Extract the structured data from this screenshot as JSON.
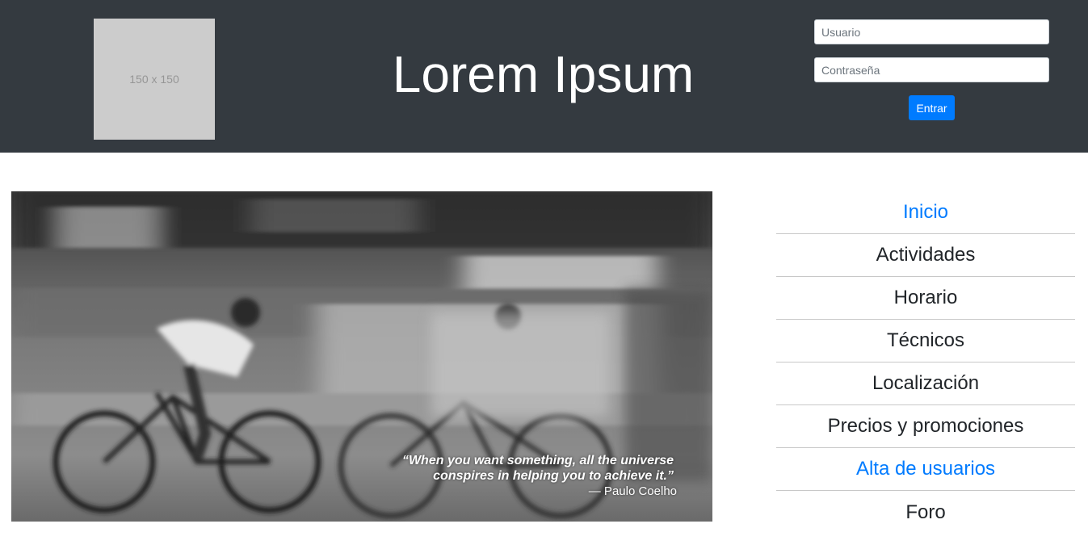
{
  "header": {
    "logo_text": "150 x 150",
    "site_title": "Lorem Ipsum",
    "background_color": "#343a40"
  },
  "login": {
    "username_placeholder": "Usuario",
    "username_value": "",
    "password_placeholder": "Contraseña",
    "password_value": "",
    "submit_label": "Entrar",
    "accent_color": "#007bff"
  },
  "hero": {
    "image_subject": "black-and-white motion-blurred photo of cyclists racing",
    "quote": "“When you want something, all the universe conspires in helping you to achieve it.”",
    "author": "— Paulo Coelho"
  },
  "nav": {
    "items": [
      {
        "label": "Inicio",
        "highlighted": true
      },
      {
        "label": "Actividades",
        "highlighted": false
      },
      {
        "label": "Horario",
        "highlighted": false
      },
      {
        "label": "Técnicos",
        "highlighted": false
      },
      {
        "label": "Localización",
        "highlighted": false
      },
      {
        "label": "Precios y promociones",
        "highlighted": false
      },
      {
        "label": "Alta de usuarios",
        "highlighted": true
      },
      {
        "label": "Foro",
        "highlighted": false
      }
    ],
    "highlight_color": "#007bff"
  }
}
